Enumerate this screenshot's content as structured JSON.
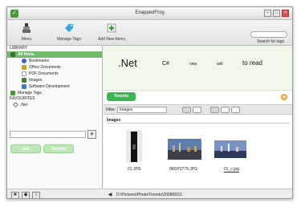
{
  "window": {
    "title": "EnappedFrog"
  },
  "toolbar": {
    "menu_label": "Menu",
    "manage_tags_label": "Manage Tags",
    "add_items_label": "Add New Items",
    "search_label": "Search for tags",
    "search_placeholder": ""
  },
  "sidebar": {
    "library_header": "LIBRARY",
    "library_items": [
      {
        "label": "All Items",
        "icon": "folder-icon",
        "color": "#2f7a2a",
        "selected": true
      },
      {
        "label": "Bookmarks",
        "icon": "bookmark-icon",
        "color": "#3b63c4"
      },
      {
        "label": "Office Documents",
        "icon": "document-icon",
        "color": "#c9a12a"
      },
      {
        "label": "PDF Documents",
        "icon": "pdf-icon",
        "color": "#d8d8d8"
      },
      {
        "label": "Images",
        "icon": "image-icon",
        "color": "#4a7a3f"
      },
      {
        "label": "Software Development",
        "icon": "code-icon",
        "color": "#3e7ec8"
      },
      {
        "label": "Manage Tags",
        "icon": "tag-icon",
        "color": "#4a9a3a"
      }
    ],
    "favourites_header": "FAVOURITES",
    "favourite_items": [
      {
        "label": ".Net",
        "icon": "tag-icon"
      }
    ],
    "selected_tags": [
      "sell",
      "Toronto"
    ]
  },
  "tag_cloud": [
    {
      "label": ".Net",
      "size": "large"
    },
    {
      "label": "C#",
      "size": "medium"
    },
    {
      "label": "new",
      "size": "small"
    },
    {
      "label": "sell",
      "size": "small"
    },
    {
      "label": "to read",
      "size": "medium"
    }
  ],
  "active_tag": {
    "label": "Toronto"
  },
  "filter": {
    "label": "Filter",
    "value": "Images"
  },
  "results": {
    "section_title": "Images",
    "items": [
      {
        "caption": "01.JPG"
      },
      {
        "caption": "IMGP2779.JPG"
      },
      {
        "caption": "01_c.jpg",
        "selected": true
      }
    ]
  },
  "status": {
    "path": "D:\\Pictures\\Photo\\Toronto\\20080831\\"
  },
  "colors": {
    "accent": "#3cb554",
    "selection": "#6fb96a",
    "cloud_bg": "#f0f8ec"
  }
}
